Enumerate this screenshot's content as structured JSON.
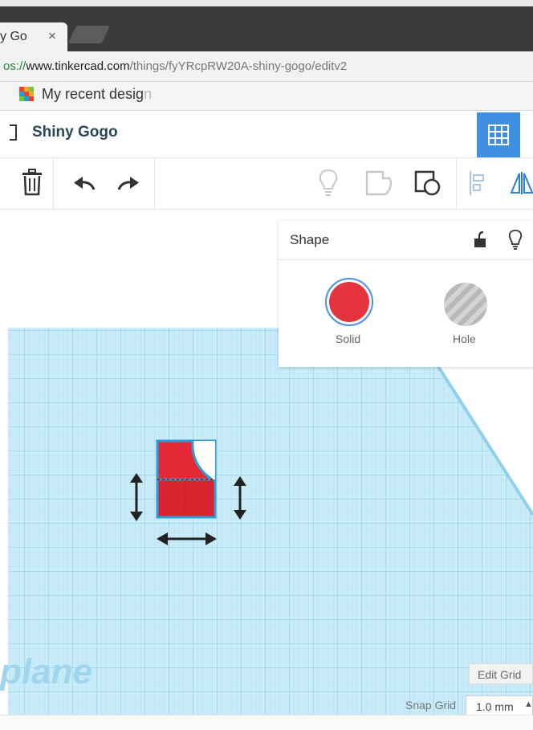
{
  "browser": {
    "tab_title": "y Go",
    "tab_close": "×",
    "url_scheme": "os://",
    "url_host": "www.tinkercad.com",
    "url_path": "/things/fyYRcpRW20A-shiny-gogo/editv2",
    "bookmark_label": "My recent desig",
    "bookmark_fade": "n"
  },
  "app": {
    "design_title": "Shiny Gogo"
  },
  "shape_panel": {
    "title": "Shape",
    "solid_label": "Solid",
    "hole_label": "Hole",
    "solid_color": "#e5343f"
  },
  "workplane": {
    "label": "plane",
    "edit_grid_label": "Edit Grid",
    "snap_grid_label": "Snap Grid",
    "snap_grid_value": "1.0 mm",
    "snap_arrow": "▲"
  },
  "colors": {
    "accent": "#3f8fe0",
    "grid": "#bfe6f5",
    "grid_line": "#8fcde6"
  }
}
